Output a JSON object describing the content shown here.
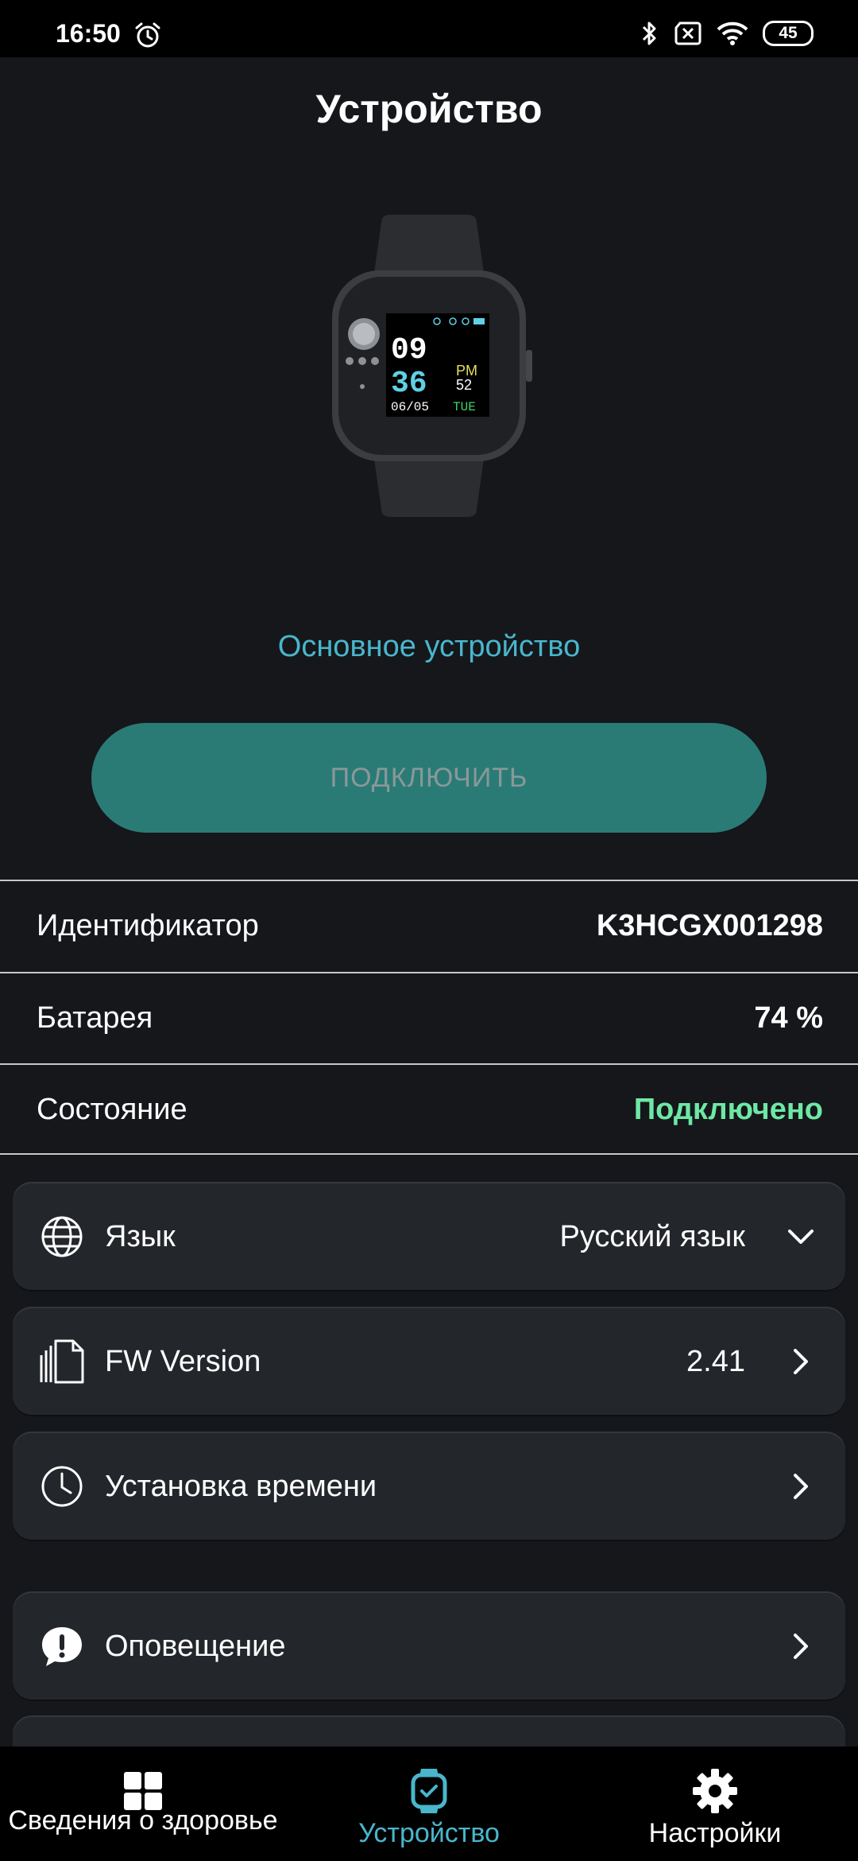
{
  "status_bar": {
    "time": "16:50",
    "battery": "45"
  },
  "header": {
    "title": "Устройство"
  },
  "device": {
    "name": "Основное устройство",
    "connect_label": "ПОДКЛЮЧИТЬ",
    "watch_face": {
      "hour": "09",
      "minute": "36",
      "ampm": "PM",
      "seconds": "52",
      "date": "06/05",
      "day": "TUE"
    }
  },
  "info": {
    "identifier_label": "Идентификатор",
    "identifier_value": "K3HCGX001298",
    "battery_label": "Батарея",
    "battery_value": "74 %",
    "state_label": "Состояние",
    "state_value": "Подключено"
  },
  "settings": {
    "language_label": "Язык",
    "language_value": "Русский язык",
    "fw_label": "FW Version",
    "fw_value": "2.41",
    "time_label": "Установка времени",
    "notify_label": "Оповещение"
  },
  "nav": {
    "health_label": "Сведения о здоровье",
    "device_label": "Устройство",
    "settings_label": "Настройки"
  },
  "colors": {
    "accent": "#49b6cc",
    "button": "#2a7b76",
    "connected": "#6ee8a4",
    "background": "#15171b",
    "card": "#23262b"
  }
}
